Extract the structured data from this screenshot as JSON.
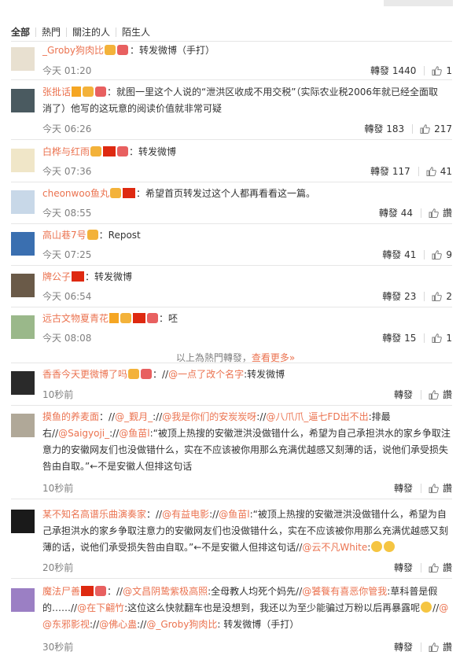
{
  "tabs": [
    "全部",
    "熱門",
    "關注的人",
    "陌生人"
  ],
  "comments": [
    {
      "name": "_Groby狗肉比",
      "text": "：转发微博（手打）",
      "time": "今天 01:20",
      "repost_label": "轉發",
      "repost": "1440",
      "likes": "1"
    },
    {
      "name": "张批话",
      "text_a": "：就图一里这个人说的“泄洪区收成不用交税”（实际农业税2006年就已经全面取",
      "text_b": "消了）他写的这玩意的阅读价值就非常可疑",
      "time": "今天 06:26",
      "repost_label": "轉發",
      "repost": "183",
      "likes": "217"
    },
    {
      "name": "白桦与红雨",
      "text": "：转发微博",
      "time": "今天 07:36",
      "repost_label": "轉發",
      "repost": "117",
      "likes": "41"
    },
    {
      "name": "cheonwoo鱼丸",
      "text": "：希望首页转发过这个人都再看看这一篇。",
      "time": "今天 08:55",
      "repost_label": "轉發",
      "repost": "44",
      "likes": "讚"
    },
    {
      "name": "高山巷7号",
      "text": "：Repost",
      "time": "今天 07:25",
      "repost_label": "轉發",
      "repost": "41",
      "likes": "9"
    },
    {
      "name": "牌公子",
      "text": "：转发微博",
      "time": "今天 06:54",
      "repost_label": "轉發",
      "repost": "23",
      "likes": "2"
    },
    {
      "name": "远古文物夏青花",
      "text": "：呸",
      "time": "今天 08:08",
      "repost_label": "轉發",
      "repost": "15",
      "likes": "1"
    }
  ],
  "more": {
    "prefix": "以上為熱門轉發，",
    "link": "查看更多»"
  },
  "recent": [
    {
      "name": "香香今天更微博了吗",
      "t1": "：//",
      "l1": "@一点了改个名字",
      "t2": ":转发微博",
      "time": "10秒前",
      "repost_label": "轉發",
      "likes": "讚"
    },
    {
      "name": "摸鱼的养麦面",
      "l1": "@_觐月_",
      "l2": "@我是你们的安炭炭呀",
      "l3": "@八爪爪_逼七FD出不出",
      "t1": "排最",
      "line2_pre": "右//",
      "l4": "@Saigyoji_",
      "l5": "@鱼苗l",
      "line2_text": ":“被顶上热搜的安徽泄洪没做错什么，希望为自己承担洪水的家乡争取注",
      "line3": "意力的安徽网友们也没做错什么，实在不应该被你用那么充满优越感又刻薄的话，说他们承受损失",
      "line4": "咎由自取。”←不是安徽人但排这句话",
      "time": "10秒前",
      "repost_label": "轉發",
      "likes": "讚"
    },
    {
      "name": "某不知名高谱乐曲演奏家",
      "l1": "@有益电影",
      "l2": "@鱼苗l",
      "line1_text": ":“被顶上热搜的安徽泄洪没做错什么，希望为自",
      "line2": "己承担洪水的家乡争取注意力的安徽网友们也没做错什么，实在不应该被你用那么充满优越感又刻",
      "line3_pre": "薄的话，说他们承受损失咎由自取。”←不是安徽人但排这句话//",
      "l3": "@云不凡White",
      "time": "20秒前",
      "repost_label": "轉發",
      "likes": "讚"
    },
    {
      "name": "魔法尸善",
      "t_pre": "：//",
      "l1": "@文昌阴鸷紫极高照",
      "t1": ":全母教人均死个妈先//",
      "l2": "@饕餮有喜恶你管我",
      "t2": ":草科普是假",
      "line2_pre": "的……//",
      "l3": "@在下翩竹",
      "line2_text": ":这位这么快就翻车也是没想到，我还以为至少能骗过万粉以后再暴露呢",
      "l4": "@东邪影视",
      "l5": "@佛心蛊",
      "l6": "@_Groby狗肉比",
      "t3": ": 转发微博（手打）",
      "time": "30秒前",
      "repost_label": "轉發",
      "likes": "讚"
    }
  ],
  "colors": {
    "link": "#eb7350",
    "meta": "#808080",
    "text": "#333333",
    "divider": "#e6e6e6"
  }
}
